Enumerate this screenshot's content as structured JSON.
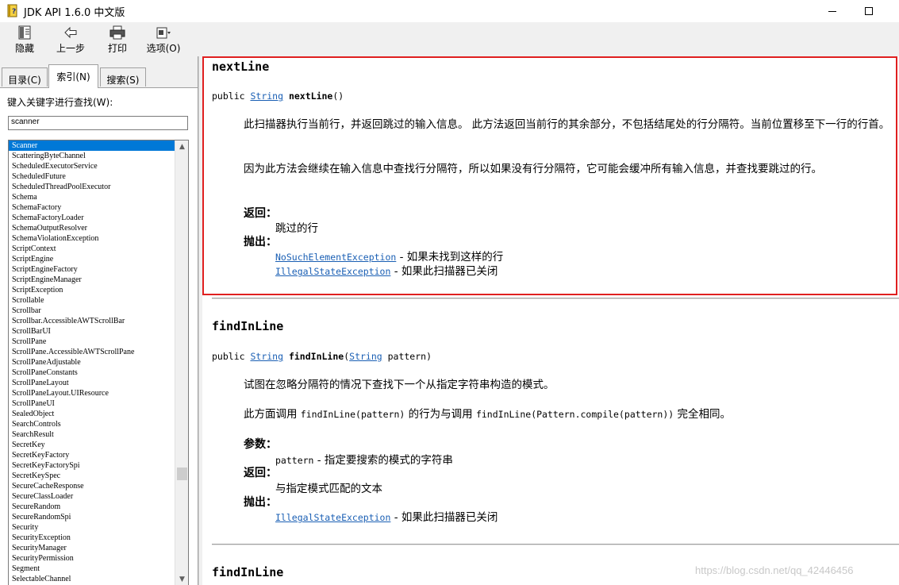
{
  "window": {
    "title": "JDK API 1.6.0 中文版"
  },
  "toolbar": {
    "hide": "隐藏",
    "back": "上一步",
    "print": "打印",
    "options": "选项(O)"
  },
  "tabs": {
    "contents": "目录(C)",
    "index": "索引(N)",
    "search": "搜索(S)"
  },
  "index_panel": {
    "label": "键入关键字进行查找(W):",
    "query": "scanner",
    "items": [
      "Scanner",
      "ScatteringByteChannel",
      "ScheduledExecutorService",
      "ScheduledFuture",
      "ScheduledThreadPoolExecutor",
      "Schema",
      "SchemaFactory",
      "SchemaFactoryLoader",
      "SchemaOutputResolver",
      "SchemaViolationException",
      "ScriptContext",
      "ScriptEngine",
      "ScriptEngineFactory",
      "ScriptEngineManager",
      "ScriptException",
      "Scrollable",
      "Scrollbar",
      "Scrollbar.AccessibleAWTScrollBar",
      "ScrollBarUI",
      "ScrollPane",
      "ScrollPane.AccessibleAWTScrollPane",
      "ScrollPaneAdjustable",
      "ScrollPaneConstants",
      "ScrollPaneLayout",
      "ScrollPaneLayout.UIResource",
      "ScrollPaneUI",
      "SealedObject",
      "SearchControls",
      "SearchResult",
      "SecretKey",
      "SecretKeyFactory",
      "SecretKeyFactorySpi",
      "SecretKeySpec",
      "SecureCacheResponse",
      "SecureClassLoader",
      "SecureRandom",
      "SecureRandomSpi",
      "Security",
      "SecurityException",
      "SecurityManager",
      "SecurityPermission",
      "Segment",
      "SelectableChannel"
    ]
  },
  "content": {
    "m1": {
      "name": "nextLine",
      "sig_pre": "public ",
      "sig_type": "String",
      "sig_name": "nextLine",
      "sig_post": "()",
      "desc1": "此扫描器执行当前行，并返回跳过的输入信息。 此方法返回当前行的其余部分，不包括结尾处的行分隔符。当前位置移至下一行的行首。",
      "desc2": "因为此方法会继续在输入信息中查找行分隔符，所以如果没有行分隔符，它可能会缓冲所有输入信息，并查找要跳过的行。",
      "returns_label": "返回：",
      "returns": "跳过的行",
      "throws_label": "抛出：",
      "t1_name": "NoSuchElementException",
      "t1_desc": " - 如果未找到这样的行",
      "t2_name": "IllegalStateException",
      "t2_desc": " - 如果此扫描器已关闭"
    },
    "m2": {
      "name": "findInLine",
      "sig_pre": "public ",
      "sig_type": "String",
      "sig_name": "findInLine",
      "sig_paren": "(",
      "sig_ptype": "String",
      "sig_post": " pattern)",
      "desc1": "试图在忽略分隔符的情况下查找下一个从指定字符串构造的模式。",
      "desc2_a": "此方面调用 ",
      "desc2_code1": "findInLine(pattern)",
      "desc2_b": " 的行为与调用 ",
      "desc2_code2": "findInLine(Pattern.compile(pattern))",
      "desc2_c": " 完全相同。",
      "params_label": "参数：",
      "param_name": "pattern",
      "param_desc": " - 指定要搜索的模式的字符串",
      "returns_label": "返回：",
      "returns": "与指定模式匹配的文本",
      "throws_label": "抛出：",
      "t1_name": "IllegalStateException",
      "t1_desc": " - 如果此扫描器已关闭"
    },
    "m3": {
      "name": "findInLine"
    }
  },
  "watermark": "https://blog.csdn.net/qq_42446456"
}
